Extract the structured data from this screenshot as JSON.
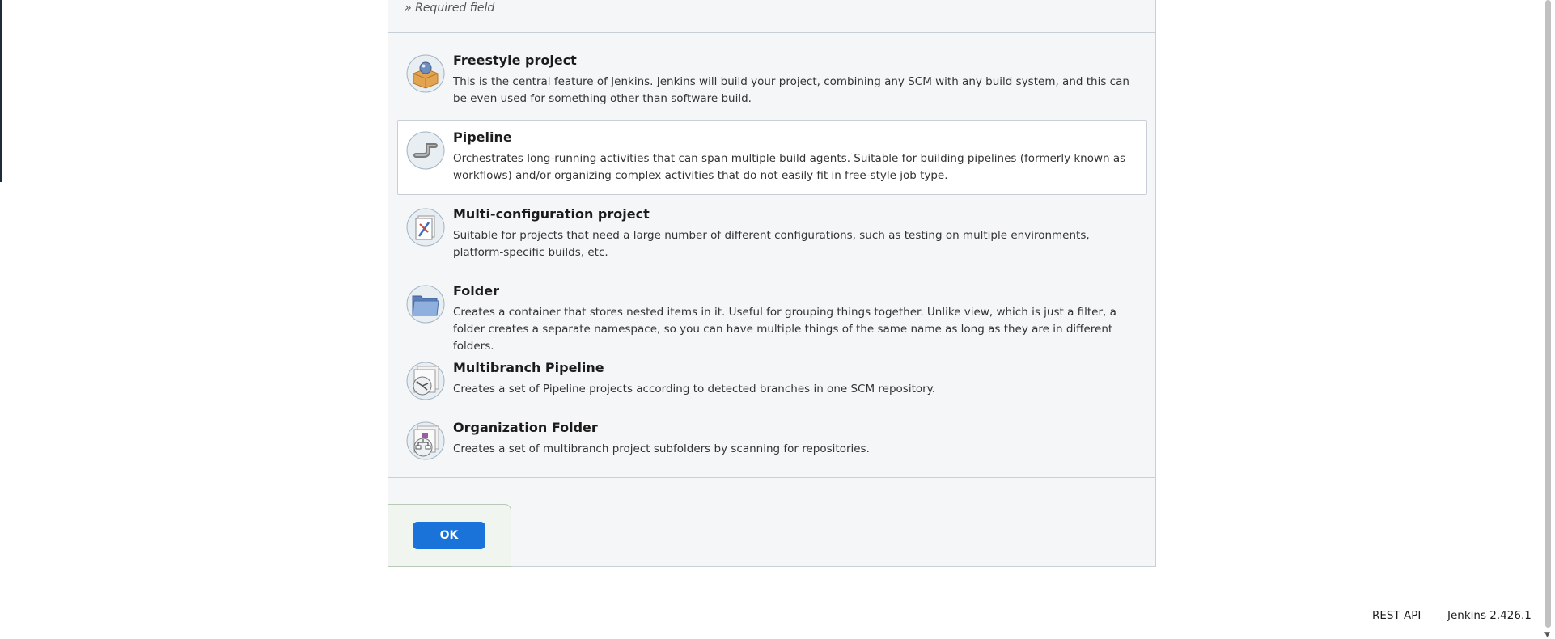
{
  "form": {
    "required_note": "» Required field"
  },
  "items": [
    {
      "title": "Freestyle project",
      "desc": "This is the central feature of Jenkins. Jenkins will build your project, combining any SCM with any build system, and this can be even used for something other than software build.",
      "icon": "freestyle-box-icon",
      "selected": false
    },
    {
      "title": "Pipeline",
      "desc": "Orchestrates long-running activities that can span multiple build agents. Suitable for building pipelines (formerly known as workflows) and/or organizing complex activities that do not easily fit in free-style job type.",
      "icon": "pipeline-pipe-icon",
      "selected": true
    },
    {
      "title": "Multi-configuration project",
      "desc": "Suitable for projects that need a large number of different configurations, such as testing on multiple environments, platform-specific builds, etc.",
      "icon": "multi-config-icon",
      "selected": false
    },
    {
      "title": "Folder",
      "desc": "Creates a container that stores nested items in it. Useful for grouping things together. Unlike view, which is just a filter, a folder creates a separate namespace, so you can have multiple things of the same name as long as they are in different folders.",
      "icon": "folder-icon",
      "selected": false
    },
    {
      "title": "Multibranch Pipeline",
      "desc": "Creates a set of Pipeline projects according to detected branches in one SCM repository.",
      "icon": "multibranch-icon",
      "selected": false
    },
    {
      "title": "Organization Folder",
      "desc": "Creates a set of multibranch project subfolders by scanning for repositories.",
      "icon": "org-folder-icon",
      "selected": false
    }
  ],
  "actions": {
    "ok_label": "OK"
  },
  "footer": {
    "rest_api": "REST API",
    "version": "Jenkins 2.426.1"
  },
  "colors": {
    "accent": "#1a73d8",
    "panel_bg": "#f5f6f7"
  }
}
